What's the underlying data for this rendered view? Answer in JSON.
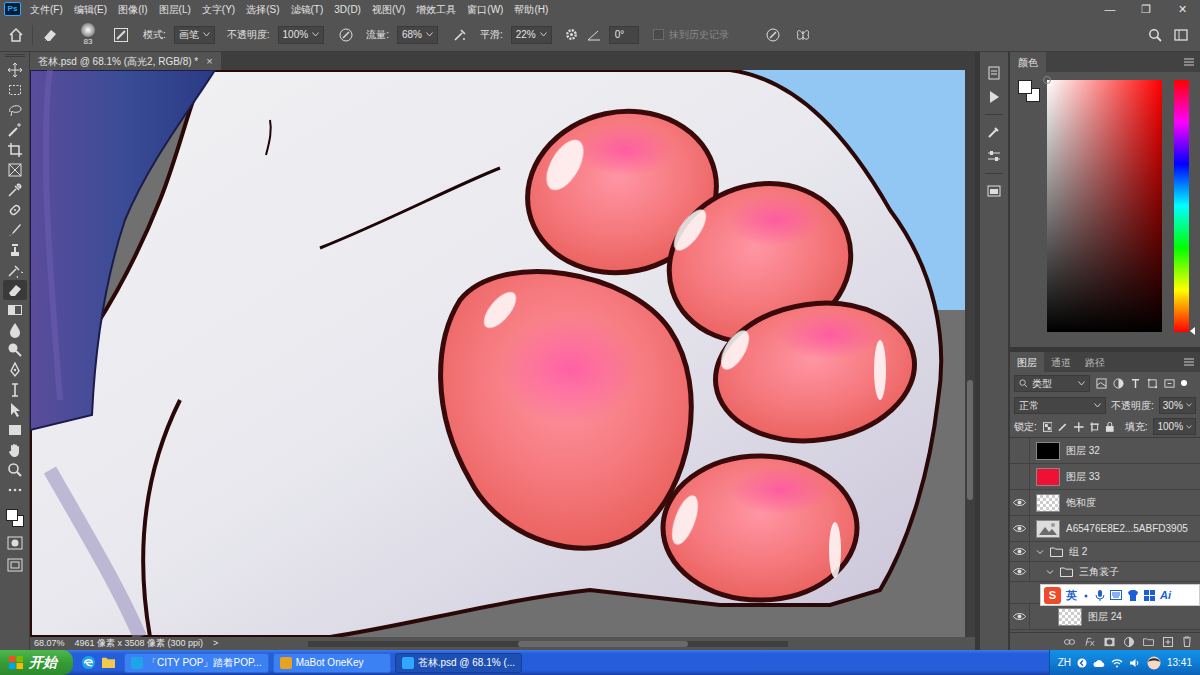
{
  "app": {
    "logo": "Ps",
    "menus": [
      "文件(F)",
      "编辑(E)",
      "图像(I)",
      "图层(L)",
      "文字(Y)",
      "选择(S)",
      "滤镜(T)",
      "3D(D)",
      "视图(V)",
      "增效工具",
      "窗口(W)",
      "帮助(H)"
    ],
    "window_controls": [
      "—",
      "❐",
      "✕"
    ]
  },
  "options_bar": {
    "brush_size": "83",
    "mode_label": "模式:",
    "mode": "画笔",
    "opacity_label": "不透明度:",
    "opacity": "100%",
    "flow_label": "流量:",
    "flow": "68%",
    "smoothing_label": "平滑:",
    "smoothing": "22%",
    "angle": "0°",
    "erase_to_history": {
      "label": "抹到历史记录",
      "checked": false,
      "disabled": true
    }
  },
  "toolbar": {
    "tools": [
      {
        "selected": false
      },
      {
        "selected": false
      },
      {
        "selected": false
      },
      {
        "selected": false
      },
      {
        "selected": false
      },
      {
        "selected": false
      },
      {
        "selected": false
      },
      {
        "selected": false
      },
      {
        "selected": false
      },
      {
        "selected": false
      },
      {
        "selected": false
      },
      {
        "selected": true
      },
      {
        "selected": false
      },
      {
        "selected": false
      },
      {
        "selected": false
      },
      {
        "selected": false
      },
      {
        "selected": false
      },
      {
        "selected": false
      },
      {
        "selected": false
      },
      {
        "selected": false
      },
      {
        "selected": false
      },
      {
        "selected": false
      }
    ]
  },
  "document_tab": {
    "title": "苍林.psd @ 68.1% (高光2, RGB/8) *",
    "close": "×"
  },
  "status_bar": {
    "zoom": "68.07%",
    "info": "4961 像素 x 3508 像素 (300 ppi)",
    "arrow": ">"
  },
  "color_panel": {
    "tab": "颜色"
  },
  "layers_panel": {
    "tabs": [
      {
        "label": "图层",
        "selected": true
      },
      {
        "label": "通道",
        "selected": false
      },
      {
        "label": "路径",
        "selected": false
      }
    ],
    "filter": "类型",
    "blend_mode": "正常",
    "opacity_label": "不透明度:",
    "opacity": "30%",
    "lock_label": "锁定:",
    "fill_label": "填充:",
    "fill": "100%",
    "layers": [
      {
        "name": "图层 32",
        "visible": false,
        "kind": "fill",
        "color": "#000000",
        "depth": 0
      },
      {
        "name": "图层 33",
        "visible": false,
        "kind": "fill",
        "color": "#ee1133",
        "depth": 0
      },
      {
        "name": "饱和度",
        "visible": true,
        "kind": "layer",
        "depth": 0
      },
      {
        "name": "A65476E8E2...5ABFD3905",
        "visible": true,
        "kind": "image",
        "depth": 0
      },
      {
        "name": "组 2",
        "visible": true,
        "kind": "group",
        "expanded": true,
        "depth": 0
      },
      {
        "name": "三角裳子",
        "visible": true,
        "kind": "group",
        "expanded": true,
        "depth": 1
      },
      {
        "name": "图层 24",
        "visible": true,
        "kind": "layer",
        "depth": 2
      }
    ]
  },
  "ime_bar": {
    "logo": "S",
    "mode": "英",
    "ai": "Ai"
  },
  "taskbar": {
    "start": "开始",
    "tasks": [
      {
        "label": "「CITY POP」踏着POP...",
        "active": false
      },
      {
        "label": "MaBot OneKey",
        "active": false
      },
      {
        "label": "苍林.psd @ 68.1% (...",
        "active": true
      }
    ],
    "lang": "ZH",
    "time": "13:41"
  }
}
